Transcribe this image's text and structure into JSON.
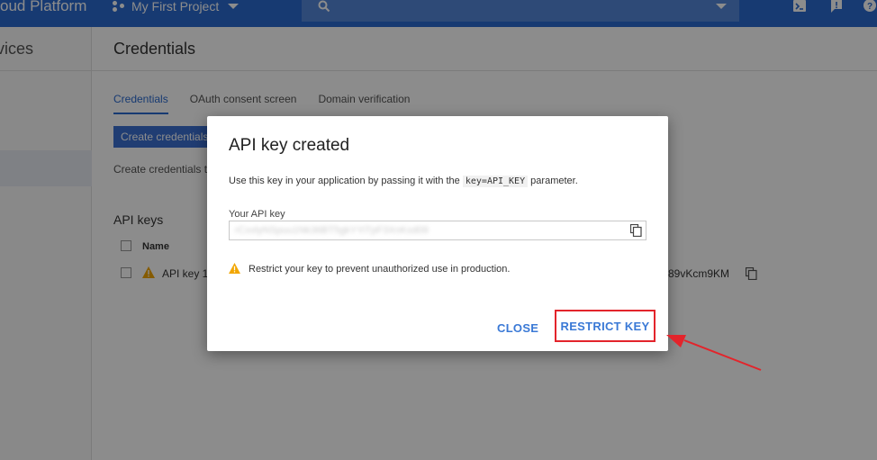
{
  "header": {
    "brand": "oud Platform",
    "project": "My First Project"
  },
  "leftnav": {
    "services_label": "vices"
  },
  "page": {
    "title": "Credentials",
    "tabs": [
      {
        "label": "Credentials",
        "active": true
      },
      {
        "label": "OAuth consent screen",
        "active": false
      },
      {
        "label": "Domain verification",
        "active": false
      }
    ],
    "create_button": "Create credentials",
    "create_hint": "Create credentials t",
    "api_keys_heading": "API keys",
    "table": {
      "column_name": "Name",
      "rows": [
        {
          "name": "API key 1",
          "key_suffix": "89vKcm9KM"
        }
      ]
    }
  },
  "dialog": {
    "title": "API key created",
    "message_prefix": "Use this key in your application by passing it with the",
    "message_code": "key=API_KEY",
    "message_suffix": "parameter.",
    "key_label": "Your API key",
    "key_value": "rCxxlyNSpuu1Nk36BT5gkYYiTpF3XnKxd09",
    "warning": "Restrict your key to prevent unauthorized use in production.",
    "close_button": "CLOSE",
    "restrict_button": "RESTRICT KEY"
  },
  "colors": {
    "topbar": "#2a6ad0",
    "accent": "#3a79d6",
    "highlight": "#e3242b",
    "warning": "#f2a600"
  }
}
